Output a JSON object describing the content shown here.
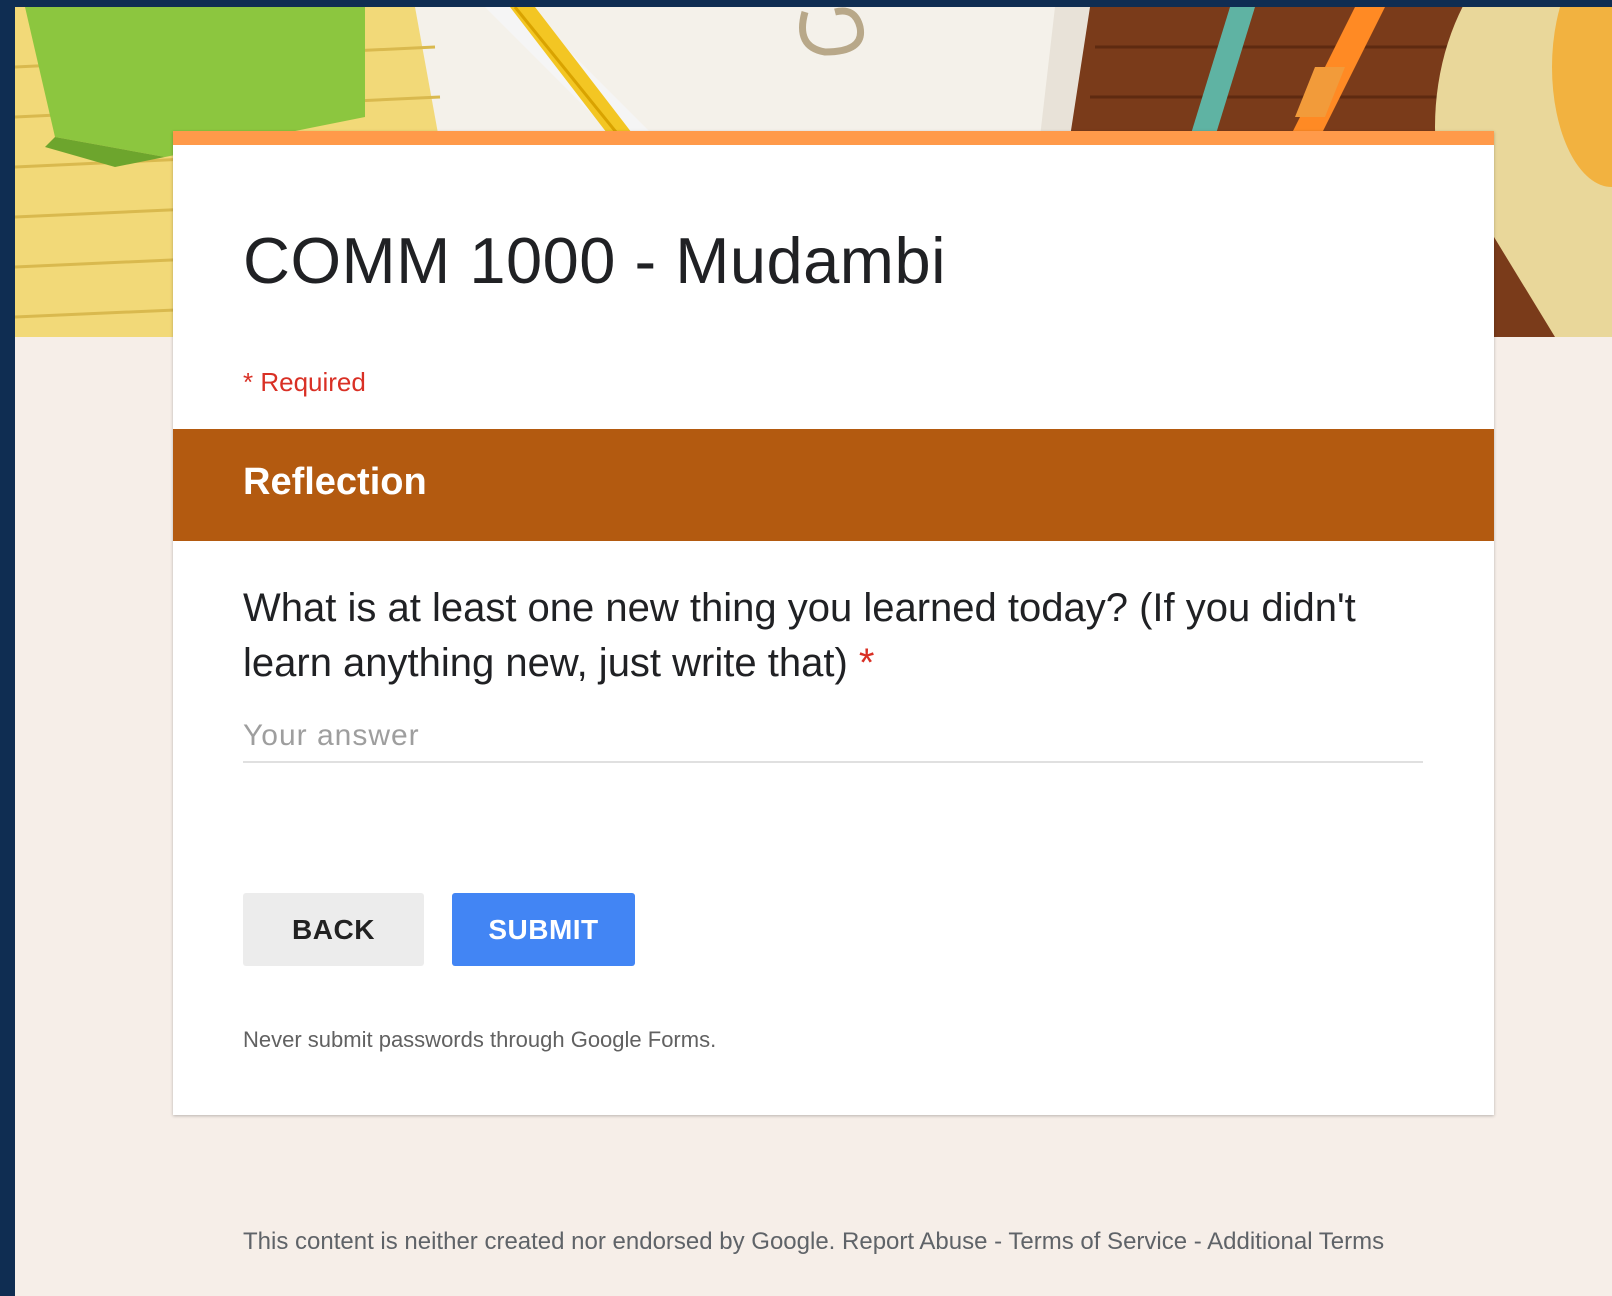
{
  "form": {
    "title": "COMM 1000 - Mudambi",
    "required_note": "* Required"
  },
  "section": {
    "title": "Reflection"
  },
  "question": {
    "text": "What is at least one new thing you learned today? (If you didn't learn anything new, just write that)",
    "required_marker": "*",
    "placeholder": "Your answer",
    "value": ""
  },
  "buttons": {
    "back_label": "BACK",
    "submit_label": "SUBMIT"
  },
  "password_warning": "Never submit passwords through Google Forms.",
  "footer": {
    "disclaimer": "This content is neither created nor endorsed by Google.",
    "report_abuse": "Report Abuse",
    "separator": " - ",
    "terms_of_service": "Terms of Service",
    "additional_terms": "Additional Terms"
  },
  "colors": {
    "accent_top_bar": "#ff9a4a",
    "section_bar": "#b35a10",
    "submit_button": "#4285f4",
    "required": "#d93025",
    "page_background": "#f6eee8",
    "outer_frame": "#0f2d52"
  },
  "icons": [
    "notepad-illustration",
    "pencil-illustration",
    "paperclip-illustration",
    "backpack-illustration",
    "hat-illustration"
  ]
}
